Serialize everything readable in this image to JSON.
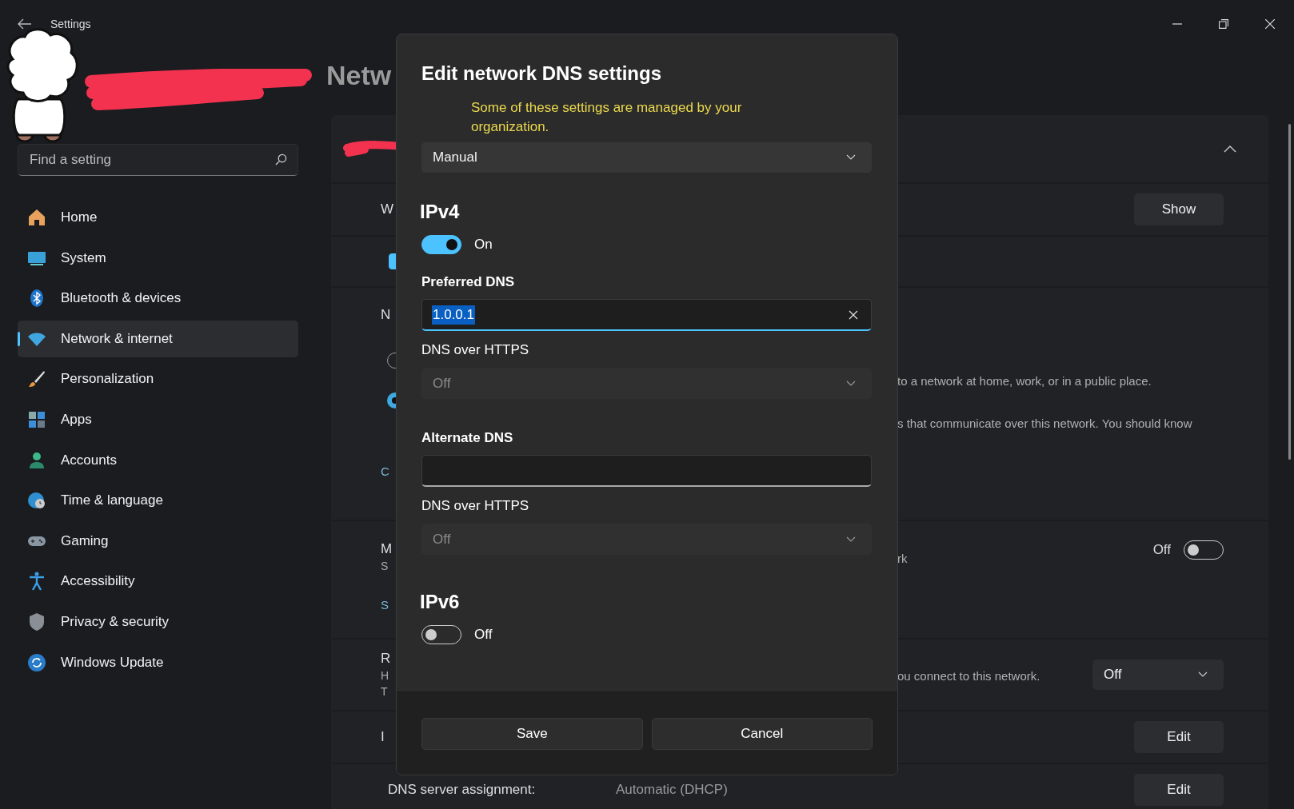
{
  "window": {
    "title": "Settings"
  },
  "sidebar": {
    "search": {
      "placeholder": "Find a setting"
    },
    "items": [
      {
        "label": "Home",
        "selected": false
      },
      {
        "label": "System",
        "selected": false
      },
      {
        "label": "Bluetooth & devices",
        "selected": false
      },
      {
        "label": "Network & internet",
        "selected": true
      },
      {
        "label": "Personalization",
        "selected": false
      },
      {
        "label": "Apps",
        "selected": false
      },
      {
        "label": "Accounts",
        "selected": false
      },
      {
        "label": "Time & language",
        "selected": false
      },
      {
        "label": "Gaming",
        "selected": false
      },
      {
        "label": "Accessibility",
        "selected": false
      },
      {
        "label": "Privacy & security",
        "selected": false
      },
      {
        "label": "Windows Update",
        "selected": false
      }
    ]
  },
  "page": {
    "title": "Netw",
    "rows": [
      {
        "kind": "header",
        "expanded": true
      },
      {
        "kind": "button",
        "left": [
          "W"
        ],
        "button": "Show"
      },
      {
        "kind": "checkbox",
        "checked": true
      },
      {
        "kind": "radios",
        "left": [
          "N"
        ],
        "radios": [
          {
            "selected": false
          },
          {
            "selected": true
          }
        ],
        "texts": [
          "to a network at home, work, or in a public place.",
          "s that communicate over this network. You should know"
        ],
        "link": "C"
      },
      {
        "kind": "toggle",
        "left": [
          "M",
          "S"
        ],
        "texts": [
          "rk"
        ],
        "link": "S",
        "toggle": {
          "on": false,
          "label": "Off"
        }
      },
      {
        "kind": "dropdown",
        "left": [
          "R",
          "H",
          "T"
        ],
        "texts": [
          "ou connect to this network."
        ],
        "value": "Off"
      },
      {
        "kind": "button",
        "left": [
          "I"
        ],
        "button": "Edit"
      },
      {
        "kind": "info",
        "label": "DNS server assignment:",
        "value": "Automatic (DHCP)",
        "button": "Edit"
      }
    ]
  },
  "dialog": {
    "title": "Edit network DNS settings",
    "notice": "Some of these settings are managed by your organization.",
    "mode": {
      "value": "Manual",
      "disabled": false
    },
    "sections": [
      {
        "heading": "IPv4",
        "toggle": {
          "on": true,
          "label": "On"
        },
        "fields": [
          {
            "label": "Preferred DNS",
            "kind": "input",
            "value": "1.0.0.1",
            "value_selected": true,
            "focused": true
          },
          {
            "label": "DNS over HTTPS",
            "kind": "dropdown",
            "value": "Off",
            "disabled": true
          },
          {
            "label": "Alternate DNS",
            "kind": "input",
            "focused": false
          },
          {
            "label": "DNS over HTTPS",
            "kind": "dropdown",
            "value": "Off",
            "disabled": true
          }
        ]
      },
      {
        "heading": "IPv6",
        "toggle": {
          "on": false,
          "label": "Off"
        }
      }
    ],
    "buttons": [
      "Save",
      "Cancel"
    ]
  }
}
